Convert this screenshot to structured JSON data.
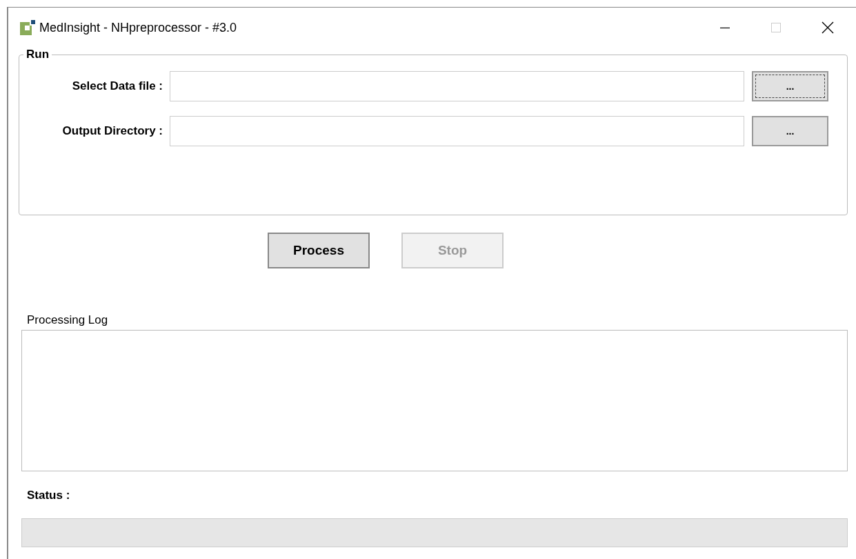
{
  "window": {
    "title": "MedInsight - NHpreprocessor - #3.0"
  },
  "run_group": {
    "title": "Run",
    "fields": [
      {
        "label": "Select Data file :",
        "browse_label": "...",
        "browse_focused": true
      },
      {
        "label": "Output Directory :",
        "browse_label": "...",
        "browse_focused": false
      }
    ]
  },
  "actions": [
    {
      "label": "Process",
      "disabled": false
    },
    {
      "label": "Stop",
      "disabled": true
    }
  ],
  "log": {
    "label": "Processing Log"
  },
  "status": {
    "label": "Status :",
    "level": 0
  }
}
